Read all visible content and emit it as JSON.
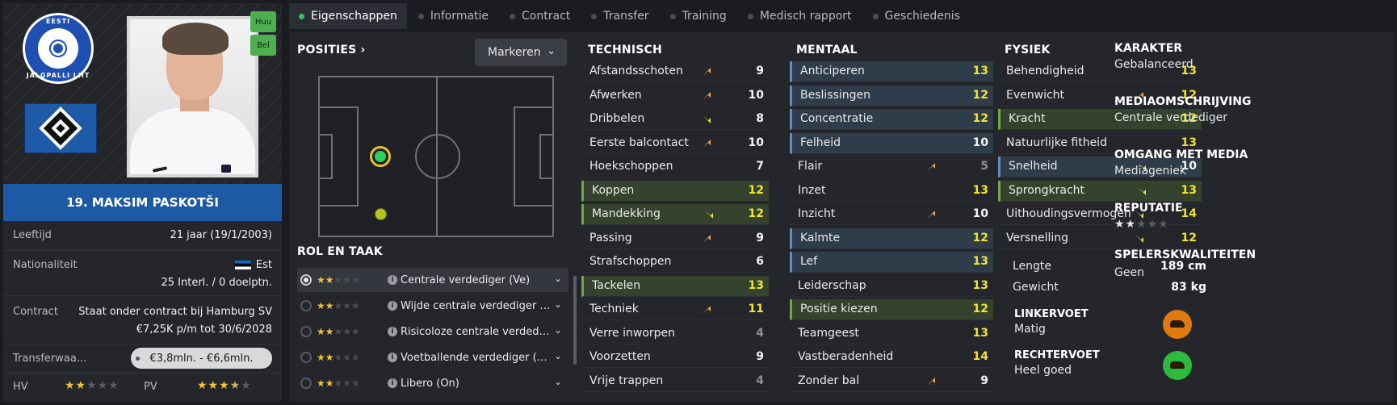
{
  "left": {
    "crest_text_top": "EESTI",
    "crest_text_bottom": "JALGPALLI LIIT",
    "tags": [
      "Huu",
      "Bel"
    ],
    "player_name": "19. MAKSIM PASKOTŠI",
    "rows": {
      "age_label": "Leeftijd",
      "age_value": "21 jaar  (19/1/2003)",
      "nat_label": "Nationaliteit",
      "nat_country": "Est",
      "nat_caps": "25 Interl. / 0 doelptn.",
      "contract_label": "Contract",
      "contract_line1": "Staat onder contract bij Hamburg SV",
      "contract_line2": "€7,25K p/m tot 30/6/2028",
      "transfer_label": "Transferwaa...",
      "transfer_value": "€3,8mln. - €6,6mln.",
      "hv_label": "HV",
      "pv_label": "PV"
    },
    "hv_stars": 2,
    "pv_stars": 3.5
  },
  "tabs": [
    "Eigenschappen",
    "Informatie",
    "Contract",
    "Transfer",
    "Training",
    "Medisch rapport",
    "Geschiedenis"
  ],
  "positions": {
    "title": "POSITIES ›",
    "marker_label": "Markeren"
  },
  "roles": {
    "title": "ROL EN TAAK",
    "items": [
      {
        "label": "Centrale verdediger (Ve)",
        "stars": 2
      },
      {
        "label": "Wijde centrale verdediger (Ve)",
        "stars": 2
      },
      {
        "label": "Risicoloze centrale verdediger (Ve)",
        "stars": 2
      },
      {
        "label": "Voetballende verdediger (Ve)",
        "stars": 2
      },
      {
        "label": "Libero (On)",
        "stars": 2
      }
    ]
  },
  "technical": {
    "title": "TECHNISCH",
    "items": [
      {
        "name": "Afstandsschoten",
        "value": 9,
        "arrow": "up",
        "style": "",
        "vcolor": "white"
      },
      {
        "name": "Afwerken",
        "value": 10,
        "arrow": "up",
        "style": "",
        "vcolor": "white"
      },
      {
        "name": "Dribbelen",
        "value": 8,
        "arrow": "down",
        "style": "",
        "vcolor": "white"
      },
      {
        "name": "Eerste balcontact",
        "value": 10,
        "arrow": "up",
        "style": "",
        "vcolor": "white"
      },
      {
        "name": "Hoekschoppen",
        "value": 7,
        "arrow": "",
        "style": "",
        "vcolor": "white"
      },
      {
        "name": "Koppen",
        "value": 12,
        "arrow": "",
        "style": "green",
        "vcolor": "yellow"
      },
      {
        "name": "Mandekking",
        "value": 12,
        "arrow": "down",
        "style": "green",
        "vcolor": "yellow"
      },
      {
        "name": "Passing",
        "value": 9,
        "arrow": "up",
        "style": "",
        "vcolor": "white"
      },
      {
        "name": "Strafschoppen",
        "value": 6,
        "arrow": "",
        "style": "",
        "vcolor": "white"
      },
      {
        "name": "Tackelen",
        "value": 13,
        "arrow": "",
        "style": "green",
        "vcolor": "yellow"
      },
      {
        "name": "Techniek",
        "value": 11,
        "arrow": "up",
        "style": "",
        "vcolor": "yellow"
      },
      {
        "name": "Verre inworpen",
        "value": 4,
        "arrow": "",
        "style": "",
        "vcolor": "grey"
      },
      {
        "name": "Voorzetten",
        "value": 9,
        "arrow": "",
        "style": "",
        "vcolor": "white"
      },
      {
        "name": "Vrije trappen",
        "value": 4,
        "arrow": "",
        "style": "",
        "vcolor": "grey"
      }
    ]
  },
  "mental": {
    "title": "MENTAAL",
    "items": [
      {
        "name": "Anticiperen",
        "value": 13,
        "arrow": "",
        "style": "blue",
        "vcolor": "yellow"
      },
      {
        "name": "Beslissingen",
        "value": 12,
        "arrow": "",
        "style": "blue",
        "vcolor": "yellow"
      },
      {
        "name": "Concentratie",
        "value": 12,
        "arrow": "",
        "style": "blue",
        "vcolor": "yellow"
      },
      {
        "name": "Felheid",
        "value": 10,
        "arrow": "",
        "style": "blue",
        "vcolor": "white"
      },
      {
        "name": "Flair",
        "value": 5,
        "arrow": "up",
        "style": "",
        "vcolor": "grey"
      },
      {
        "name": "Inzet",
        "value": 13,
        "arrow": "",
        "style": "",
        "vcolor": "yellow"
      },
      {
        "name": "Inzicht",
        "value": 10,
        "arrow": "up",
        "style": "",
        "vcolor": "white"
      },
      {
        "name": "Kalmte",
        "value": 12,
        "arrow": "",
        "style": "blue",
        "vcolor": "yellow"
      },
      {
        "name": "Lef",
        "value": 13,
        "arrow": "",
        "style": "blue",
        "vcolor": "yellow"
      },
      {
        "name": "Leiderschap",
        "value": 13,
        "arrow": "",
        "style": "",
        "vcolor": "yellow"
      },
      {
        "name": "Positie kiezen",
        "value": 12,
        "arrow": "",
        "style": "green",
        "vcolor": "yellow"
      },
      {
        "name": "Teamgeest",
        "value": 13,
        "arrow": "",
        "style": "",
        "vcolor": "yellow"
      },
      {
        "name": "Vastberadenheid",
        "value": 14,
        "arrow": "",
        "style": "",
        "vcolor": "yellow"
      },
      {
        "name": "Zonder bal",
        "value": 9,
        "arrow": "up",
        "style": "",
        "vcolor": "white"
      }
    ]
  },
  "physical": {
    "title": "FYSIEK",
    "items": [
      {
        "name": "Behendigheid",
        "value": 13,
        "arrow": "",
        "style": "",
        "vcolor": "yellow"
      },
      {
        "name": "Evenwicht",
        "value": 12,
        "arrow": "up",
        "style": "",
        "vcolor": "yellow"
      },
      {
        "name": "Kracht",
        "value": 12,
        "arrow": "",
        "style": "green",
        "vcolor": "yellow"
      },
      {
        "name": "Natuurlijke fitheid",
        "value": 13,
        "arrow": "",
        "style": "",
        "vcolor": "yellow"
      },
      {
        "name": "Snelheid",
        "value": 10,
        "arrow": "down",
        "style": "blue",
        "vcolor": "white"
      },
      {
        "name": "Sprongkracht",
        "value": 13,
        "arrow": "down",
        "style": "green",
        "vcolor": "yellow"
      },
      {
        "name": "Uithoudingsvermogen",
        "value": 14,
        "arrow": "down",
        "style": "",
        "vcolor": "yellow"
      },
      {
        "name": "Versnelling",
        "value": 12,
        "arrow": "down",
        "style": "",
        "vcolor": "yellow"
      }
    ],
    "height_label": "Lengte",
    "height_value": "189 cm",
    "weight_label": "Gewicht",
    "weight_value": "83 kg",
    "left_foot_title": "LINKERVOET",
    "left_foot_value": "Matig",
    "right_foot_title": "RECHTERVOET",
    "right_foot_value": "Heel goed"
  },
  "character": {
    "karakter_title": "KARAKTER",
    "karakter_value": "Gebalanceerd",
    "media_title": "MEDIAOMSCHRIJVING",
    "media_value": "Centrale verdediger",
    "omgang_title": "OMGANG MET MEDIA",
    "omgang_value": "Mediageniek",
    "reputatie_title": "REPUTATIE",
    "reputatie_stars": 2,
    "kwaliteiten_title": "SPELERSKWALITEITEN",
    "kwaliteiten_value": "Geen"
  },
  "colors": {
    "value_yellow": "#f2e52a",
    "arrow_up": "#f5a64a",
    "arrow_down": "#e5dc3a",
    "club_blue": "#1d5aa5",
    "foot_matig": "#e07a10",
    "foot_heel_goed": "#2dbb3c"
  }
}
